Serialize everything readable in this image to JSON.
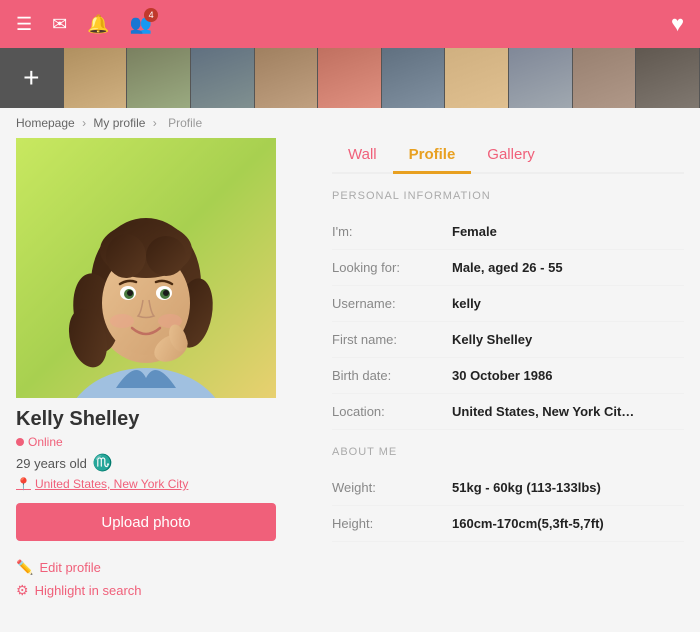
{
  "nav": {
    "badge_count": "4",
    "heart_icon": "♥"
  },
  "breadcrumb": {
    "homepage": "Homepage",
    "my_profile": "My profile",
    "profile": "Profile",
    "sep": "›"
  },
  "tabs": [
    {
      "label": "Wall",
      "id": "wall",
      "active": false
    },
    {
      "label": "Profile",
      "id": "profile",
      "active": true
    },
    {
      "label": "Gallery",
      "id": "gallery",
      "active": false
    }
  ],
  "profile": {
    "name": "Kelly Shelley",
    "online_label": "Online",
    "age": "29 years old",
    "zodiac": "♏",
    "location_link": "United States, New York City",
    "upload_btn": "Upload photo",
    "edit_profile": "Edit profile",
    "highlight_search": "Highlight in search"
  },
  "personal_info": {
    "section_title": "PERSONAL INFORMATION",
    "rows": [
      {
        "label": "I'm:",
        "value": "Female"
      },
      {
        "label": "Looking for:",
        "value": "Male, aged 26 - 55"
      },
      {
        "label": "Username:",
        "value": "kelly"
      },
      {
        "label": "First name:",
        "value": "Kelly Shelley"
      },
      {
        "label": "Birth date:",
        "value": "30 October 1986"
      },
      {
        "label": "Location:",
        "value": "United States, New York Cit…"
      }
    ]
  },
  "about_me": {
    "section_title": "ABOUT ME",
    "rows": [
      {
        "label": "Weight:",
        "value": "51kg - 60kg (113-133lbs)"
      },
      {
        "label": "Height:",
        "value": "160cm-170cm(5,3ft-5,7ft)"
      }
    ]
  },
  "strip_photos": [
    {
      "alt": "add photo",
      "type": "add"
    },
    {
      "alt": "person1",
      "type": "photo",
      "color": "#8b6f4e"
    },
    {
      "alt": "person2",
      "type": "photo",
      "color": "#7a8a6e"
    },
    {
      "alt": "person3",
      "type": "photo",
      "color": "#5a6a7a"
    },
    {
      "alt": "person4",
      "type": "photo",
      "color": "#9a8a7a"
    },
    {
      "alt": "person5",
      "type": "photo",
      "color": "#a07060"
    },
    {
      "alt": "person6",
      "type": "photo",
      "color": "#6a7080"
    },
    {
      "alt": "person7",
      "type": "photo",
      "color": "#c0a080"
    },
    {
      "alt": "person8",
      "type": "photo",
      "color": "#808898"
    },
    {
      "alt": "person9",
      "type": "photo",
      "color": "#988878"
    },
    {
      "alt": "person10",
      "type": "photo",
      "color": "#706860"
    }
  ]
}
